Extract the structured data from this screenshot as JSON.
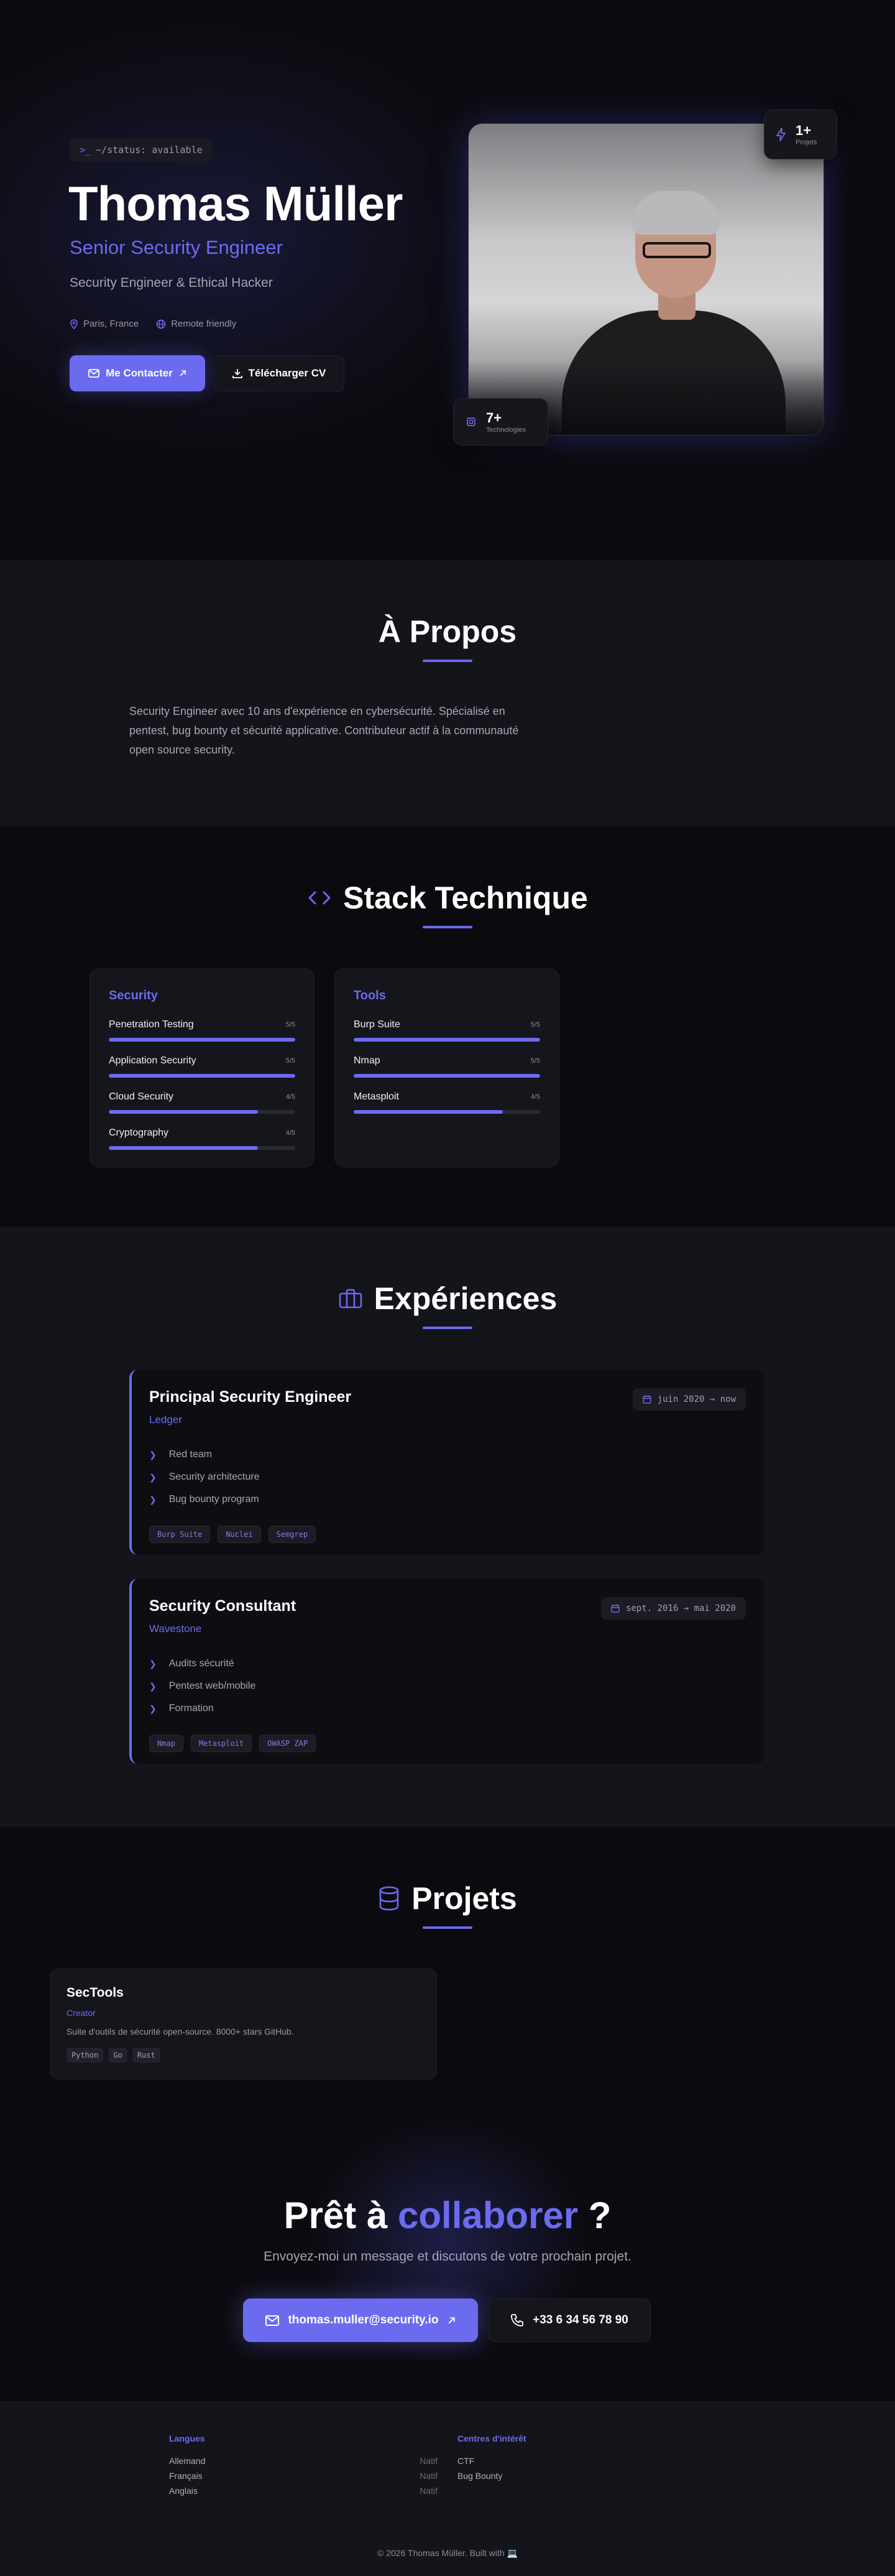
{
  "colors": {
    "accent": "#6b6bf0",
    "background": "#0b0b0f",
    "surface": "#14141b",
    "card": "#15151c"
  },
  "hero": {
    "status": "~/status: available",
    "status_prompt": ">_",
    "name": "Thomas Müller",
    "role": "Senior Security Engineer",
    "tagline": "Security Engineer & Ethical Hacker",
    "location": "Paris, France",
    "remote": "Remote friendly",
    "contact_button": "Me Contacter",
    "cv_button": "Télécharger CV",
    "projects_count": "1+",
    "projects_label": "Projets",
    "tech_count": "7+",
    "tech_label": "Technologies"
  },
  "about": {
    "title": "À Propos",
    "text": "Security Engineer avec 10 ans d'expérience en cybersécurité. Spécialisé en pentest, bug bounty et sécurité applicative. Contributeur actif à la communauté open source security."
  },
  "stack": {
    "title": "Stack Technique",
    "categories": [
      {
        "name": "Security",
        "skills": [
          {
            "name": "Penetration Testing",
            "level_label": "5/5",
            "level": 1.0
          },
          {
            "name": "Application Security",
            "level_label": "5/5",
            "level": 1.0
          },
          {
            "name": "Cloud Security",
            "level_label": "4/5",
            "level": 0.8
          },
          {
            "name": "Cryptography",
            "level_label": "4/5",
            "level": 0.8
          }
        ]
      },
      {
        "name": "Tools",
        "skills": [
          {
            "name": "Burp Suite",
            "level_label": "5/5",
            "level": 1.0
          },
          {
            "name": "Nmap",
            "level_label": "5/5",
            "level": 1.0
          },
          {
            "name": "Metasploit",
            "level_label": "4/5",
            "level": 0.8
          }
        ]
      }
    ]
  },
  "experiences": {
    "title": "Expériences",
    "items": [
      {
        "title": "Principal Security Engineer",
        "company": "Ledger",
        "date": "juin 2020 → now",
        "bullets": [
          "Red team",
          "Security architecture",
          "Bug bounty program"
        ],
        "tags": [
          "Burp Suite",
          "Nuclei",
          "Semgrep"
        ]
      },
      {
        "title": "Security Consultant",
        "company": "Wavestone",
        "date": "sept. 2016 → mai 2020",
        "bullets": [
          "Audits sécurité",
          "Pentest web/mobile",
          "Formation"
        ],
        "tags": [
          "Nmap",
          "Metasploit",
          "OWASP ZAP"
        ]
      }
    ]
  },
  "projects": {
    "title": "Projets",
    "items": [
      {
        "name": "SecTools",
        "role": "Creator",
        "description": "Suite d'outils de sécurité open-source. 8000+ stars GitHub.",
        "tags": [
          "Python",
          "Go",
          "Rust"
        ]
      }
    ]
  },
  "cta": {
    "title_before": "Prêt à ",
    "title_accent": "collaborer",
    "title_after": " ?",
    "subtitle": "Envoyez-moi un message et discutons de votre prochain projet.",
    "email": "thomas.muller@security.io",
    "phone": "+33 6 34 56 78 90"
  },
  "footer": {
    "languages_title": "Langues",
    "languages": [
      {
        "name": "Allemand",
        "level": "Natif"
      },
      {
        "name": "Français",
        "level": "Natif"
      },
      {
        "name": "Anglais",
        "level": "Natif"
      }
    ],
    "interests_title": "Centres d'intérêt",
    "interests": [
      "CTF",
      "Bug Bounty"
    ],
    "copyright": "© 2026 Thomas Müller. Built with 💻"
  }
}
